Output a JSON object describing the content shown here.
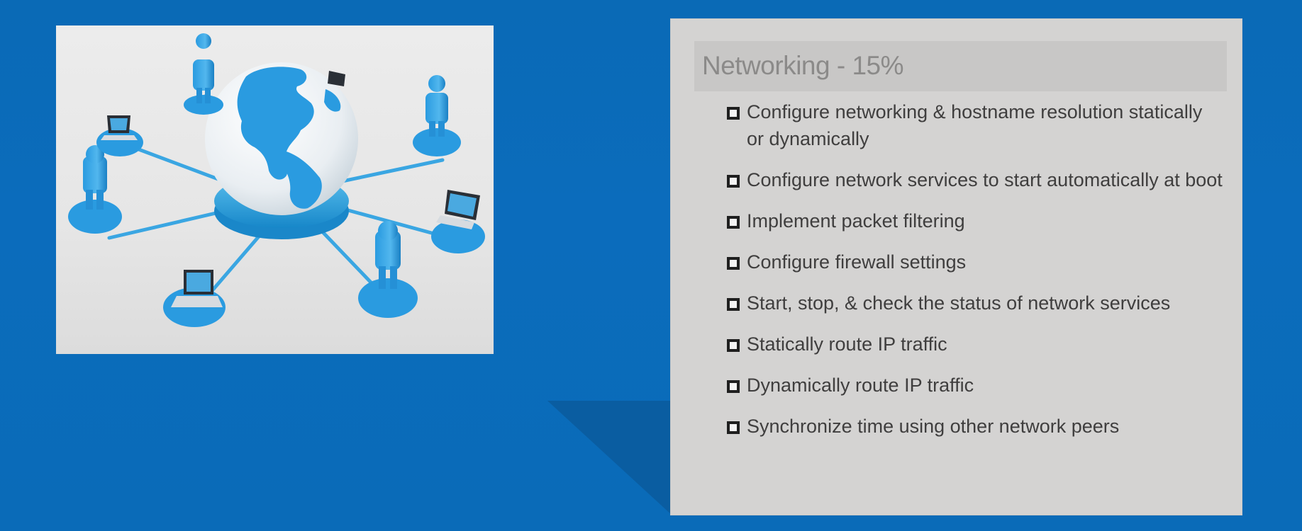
{
  "slide": {
    "card": {
      "title": "Networking - 15%",
      "items": [
        {
          "text": "Configure networking & hostname resolution statically or dynamically",
          "icon": "hollow-square-bullet-icon"
        },
        {
          "text": "Configure network services to start automatically at boot",
          "icon": "hollow-square-bullet-icon"
        },
        {
          "text": "Implement packet filtering",
          "icon": "hollow-square-bullet-icon"
        },
        {
          "text": "Configure firewall settings",
          "icon": "hollow-square-bullet-icon"
        },
        {
          "text": "Start, stop, & check the status of network services",
          "icon": "hollow-square-bullet-icon"
        },
        {
          "text": "Statically route IP traffic",
          "icon": "hollow-square-bullet-icon"
        },
        {
          "text": "Dynamically route IP traffic",
          "icon": "hollow-square-bullet-icon"
        },
        {
          "text": "Synchronize time using other network peers",
          "icon": "hollow-square-bullet-icon"
        }
      ]
    },
    "image": {
      "icon": "globe-network-illustration"
    },
    "colors": {
      "background": "#0b6cbc",
      "card": "#d4d3d2",
      "card_header": "#c8c7c6",
      "title": "#8b8a89",
      "text": "#3f3e3e",
      "illustration_blue": "#1f96d8"
    }
  }
}
